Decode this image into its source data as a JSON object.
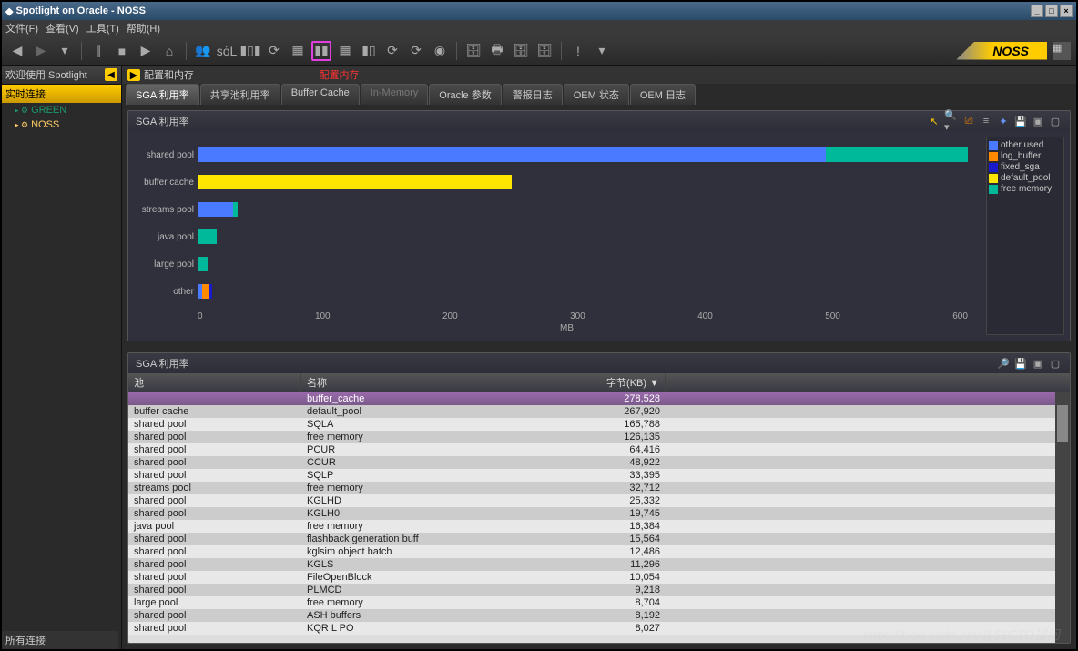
{
  "window": {
    "title": "Spotlight on Oracle - NOSS"
  },
  "menu": [
    "文件(F)",
    "查看(V)",
    "工具(T)",
    "帮助(H)"
  ],
  "brand": "NOSS",
  "sidebar": {
    "welcome": "欢迎使用 Spotlight",
    "section": "实时连接",
    "items": [
      {
        "label": "GREEN"
      },
      {
        "label": "NOSS"
      }
    ],
    "footer": "所有连接"
  },
  "crumb": {
    "label": "配置和内存",
    "annot": "配置内存"
  },
  "tabs": [
    {
      "label": "SGA 利用率",
      "active": true
    },
    {
      "label": "共享池利用率"
    },
    {
      "label": "Buffer Cache"
    },
    {
      "label": "In-Memory",
      "disabled": true
    },
    {
      "label": "Oracle 参数"
    },
    {
      "label": "警报日志"
    },
    {
      "label": "OEM 状态"
    },
    {
      "label": "OEM 日志"
    }
  ],
  "chart": {
    "title": "SGA 利用率",
    "xlabel": "MB"
  },
  "chart_data": {
    "type": "bar",
    "orientation": "horizontal",
    "stacked": true,
    "xlabel": "MB",
    "xlim": [
      0,
      650
    ],
    "xticks": [
      0,
      100,
      200,
      300,
      400,
      500,
      600
    ],
    "categories": [
      "shared pool",
      "buffer cache",
      "streams pool",
      "java pool",
      "large pool",
      "other"
    ],
    "series": [
      {
        "name": "other used",
        "color": "#4a7aff",
        "values": [
          530,
          0,
          30,
          0,
          0,
          4
        ]
      },
      {
        "name": "log_buffer",
        "color": "#ff8a00",
        "values": [
          0,
          0,
          0,
          0,
          0,
          6
        ]
      },
      {
        "name": "fixed_sga",
        "color": "#1a1acc",
        "values": [
          0,
          0,
          0,
          0,
          0,
          2
        ]
      },
      {
        "name": "default_pool",
        "color": "#ffe600",
        "values": [
          0,
          265,
          0,
          0,
          0,
          0
        ]
      },
      {
        "name": "free memory",
        "color": "#00b89a",
        "values": [
          120,
          0,
          4,
          16,
          9,
          0
        ]
      }
    ]
  },
  "table": {
    "title": "SGA 利用率",
    "columns": [
      "池",
      "名称",
      "字节(KB)"
    ],
    "rows": [
      {
        "pool": "",
        "name": "buffer_cache",
        "kb": "278,528",
        "selected": true
      },
      {
        "pool": "buffer cache",
        "name": "default_pool",
        "kb": "267,920"
      },
      {
        "pool": "shared pool",
        "name": "SQLA",
        "kb": "165,788"
      },
      {
        "pool": "shared pool",
        "name": "free memory",
        "kb": "126,135"
      },
      {
        "pool": "shared pool",
        "name": "PCUR",
        "kb": "64,416"
      },
      {
        "pool": "shared pool",
        "name": "CCUR",
        "kb": "48,922"
      },
      {
        "pool": "shared pool",
        "name": "SQLP",
        "kb": "33,395"
      },
      {
        "pool": "streams pool",
        "name": "free memory",
        "kb": "32,712"
      },
      {
        "pool": "shared pool",
        "name": "KGLHD",
        "kb": "25,332"
      },
      {
        "pool": "shared pool",
        "name": "KGLH0",
        "kb": "19,745"
      },
      {
        "pool": "java pool",
        "name": "free memory",
        "kb": "16,384"
      },
      {
        "pool": "shared pool",
        "name": "flashback generation buff",
        "kb": "15,564"
      },
      {
        "pool": "shared pool",
        "name": "kglsim object batch",
        "kb": "12,486"
      },
      {
        "pool": "shared pool",
        "name": "KGLS",
        "kb": "11,296"
      },
      {
        "pool": "shared pool",
        "name": "FileOpenBlock",
        "kb": "10,054"
      },
      {
        "pool": "shared pool",
        "name": "PLMCD",
        "kb": "9,218"
      },
      {
        "pool": "large pool",
        "name": "free memory",
        "kb": "8,704"
      },
      {
        "pool": "shared pool",
        "name": "ASH buffers",
        "kb": "8,192"
      },
      {
        "pool": "shared pool",
        "name": "KQR L PO",
        "kb": "8,027"
      }
    ]
  },
  "toolbar_icons": [
    "◀",
    "▶",
    "▼",
    "∥",
    "■",
    "▶",
    "⌂",
    "👥",
    "🔍",
    "📊",
    "🔄",
    "▦",
    "▦",
    "▦",
    "📊",
    "⟳",
    "⟳",
    "◉",
    "🗄",
    "🖨",
    "🗄",
    "🗄",
    "!",
    "▾"
  ],
  "watermark": "https://blog.csdn.net/@51CTO提问"
}
